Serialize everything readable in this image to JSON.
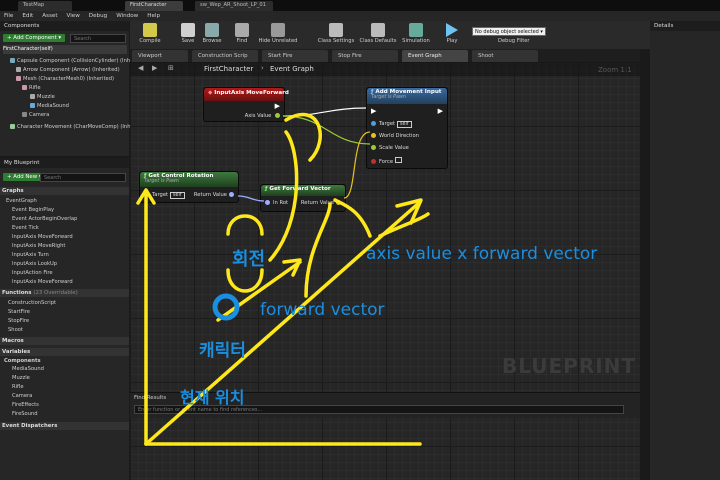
{
  "doc_tabs": [
    "TestMap",
    "FirstCharacter",
    "sw_Wep_AR_Shoot_LP_01"
  ],
  "menu": [
    "File",
    "Edit",
    "Asset",
    "View",
    "Debug",
    "Window",
    "Help"
  ],
  "components_panel": {
    "title": "Components",
    "add_button": "+ Add Component ▾",
    "search_placeholder": "Search",
    "root": "FirstCharacter(self)",
    "items": [
      "Capsule Component (CollisionCylinder) (Inherited)",
      "Arrow Component (Arrow) (Inherited)",
      "Mesh (CharacterMesh0) (Inherited)",
      "Rifle",
      "Muzzle",
      "MediaSound",
      "Camera",
      "Character Movement (CharMoveComp) (Inherited)"
    ]
  },
  "blueprint_panel": {
    "title": "My Blueprint",
    "add_button": "+ Add New ▾",
    "search_placeholder": "Search",
    "graphs_header": "Graphs",
    "event_graph": "EventGraph",
    "events": [
      "Event BeginPlay",
      "Event ActorBeginOverlap",
      "Event Tick",
      "InputAxis MoveForward",
      "InputAxis MoveRight",
      "InputAxis Turn",
      "InputAxis LookUp",
      "InputAction Fire",
      "InputAxis MoveForward"
    ],
    "functions_header": "Functions",
    "functions_note": "(23 Overridable)",
    "functions": [
      "ConstructionScript",
      "StartFire",
      "StopFire",
      "Shoot"
    ],
    "macros_header": "Macros",
    "variables_header": "Variables",
    "components_header": "Components",
    "variables": [
      "MediaSound",
      "Muzzle",
      "Rifle",
      "Camera",
      "FireEffects",
      "FireSound"
    ],
    "dispatchers_header": "Event Dispatchers"
  },
  "toolbar": {
    "buttons": [
      "Compile",
      "Save",
      "Browse",
      "Find",
      "Hide Unrelated",
      "Class Settings",
      "Class Defaults",
      "Simulation",
      "Play"
    ],
    "debug_select": "No debug object selected ▾",
    "debug_filter": "Debug Filter"
  },
  "graph_tabs": [
    "Viewport",
    "Construction Scrip",
    "Start Fire",
    "Stop Fire",
    "Event Graph",
    "Shoot"
  ],
  "breadcrumb": {
    "root": "FirstCharacter",
    "sep": "›",
    "current": "Event Graph"
  },
  "zoom": "Zoom 1:1",
  "details_title": "Details",
  "nodes": {
    "input_axis": {
      "title": "InputAxis MoveForward",
      "pin_axis": "Axis Value"
    },
    "add_movement": {
      "title": "Add Movement Input",
      "subtitle": "Target is Pawn",
      "pins": [
        "Target",
        "World Direction",
        "Scale Value",
        "Force"
      ],
      "self": "self"
    },
    "get_control_rotation": {
      "title": "Get Control Rotation",
      "subtitle": "Target is Pawn",
      "pin_target": "Target",
      "pin_return": "Return Value",
      "self": "self"
    },
    "get_forward_vector": {
      "title": "Get Forward Vector",
      "pin_in": "In Rot",
      "pin_return": "Return Value"
    }
  },
  "find_results": {
    "title": "Find Results",
    "placeholder": "Enter function or event name to find references..."
  },
  "watermark": "BLUEPRINT",
  "annotations": {
    "rotation": "회전",
    "character": "캐릭터",
    "current_position": "현재 위치",
    "forward_vector": "forward vector",
    "axis_formula": "axis value  x forward vector"
  },
  "colors": {
    "annotation_yellow": "#ffe81a",
    "annotation_blue": "#1a8fe0",
    "input_event_head": "#8b1515",
    "pure_func_head": "#2a5a2a",
    "call_func_head": "#2f4f78",
    "wire_green": "#9acd32"
  }
}
